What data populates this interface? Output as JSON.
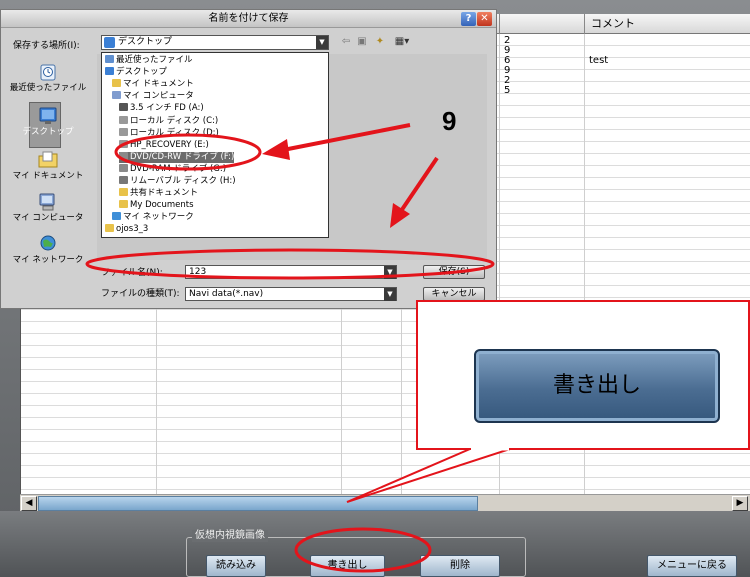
{
  "dialog": {
    "title": "名前を付けて保存",
    "save_in_label": "保存する場所(I):",
    "save_in_value": "デスクトップ",
    "places": [
      {
        "label": "最近使ったファイル",
        "icon": "recent-files-icon"
      },
      {
        "label": "デスクトップ",
        "icon": "desktop-icon"
      },
      {
        "label": "マイ ドキュメント",
        "icon": "my-documents-icon"
      },
      {
        "label": "マイ コンピュータ",
        "icon": "my-computer-icon"
      },
      {
        "label": "マイ ネットワーク",
        "icon": "my-network-icon"
      }
    ],
    "dropdown_items": [
      {
        "label": "最近使ったファイル",
        "icon": "recent-folder-icon",
        "indent": 0,
        "selected": false
      },
      {
        "label": "デスクトップ",
        "icon": "desktop-icon",
        "indent": 0,
        "selected": false
      },
      {
        "label": "マイ ドキュメント",
        "icon": "my-documents-icon",
        "indent": 1,
        "selected": false
      },
      {
        "label": "マイ コンピュータ",
        "icon": "my-computer-icon",
        "indent": 1,
        "selected": false
      },
      {
        "label": "3.5 インチ FD (A:)",
        "icon": "floppy-icon",
        "indent": 2,
        "selected": false
      },
      {
        "label": "ローカル ディスク (C:)",
        "icon": "disk-icon",
        "indent": 2,
        "selected": false
      },
      {
        "label": "ローカル ディスク (D:)",
        "icon": "disk-icon",
        "indent": 2,
        "selected": false
      },
      {
        "label": "HP_RECOVERY (E:)",
        "icon": "disk-icon",
        "indent": 2,
        "selected": false
      },
      {
        "label": "DVD/CD-RW ドライブ (F:)",
        "icon": "dvd-drive-icon",
        "indent": 2,
        "selected": true
      },
      {
        "label": "DVD-RAM ドライブ (G:)",
        "icon": "dvd-drive-icon",
        "indent": 2,
        "selected": false
      },
      {
        "label": "リムーバブル ディスク (H:)",
        "icon": "removable-disk-icon",
        "indent": 2,
        "selected": false
      },
      {
        "label": "共有ドキュメント",
        "icon": "folder-icon",
        "indent": 2,
        "selected": false
      },
      {
        "label": "My Documents",
        "icon": "folder-icon",
        "indent": 2,
        "selected": false
      },
      {
        "label": "マイ ネットワーク",
        "icon": "network-icon",
        "indent": 1,
        "selected": false
      },
      {
        "label": "ojos3_3",
        "icon": "folder-icon",
        "indent": 0,
        "selected": false
      }
    ],
    "filename_label": "ファイル名(N):",
    "filename_value": "123",
    "filetype_label": "ファイルの種類(T):",
    "filetype_value": "Navi data(*.nav)",
    "save_button": "保存(S)",
    "cancel_button": "キャンセル"
  },
  "grid": {
    "comment_header": "コメント",
    "partial_values": [
      "2",
      "9",
      "6",
      "9",
      "2",
      "5"
    ],
    "comment_values": [
      "",
      "",
      "test",
      "",
      "",
      ""
    ]
  },
  "bottom": {
    "group_label": "仮想内視鏡画像",
    "read_button": "読み込み",
    "export_button": "書き出し",
    "delete_button": "削除",
    "menu_button": "メニューに戻る"
  },
  "annotation": {
    "step_number": "9",
    "callout_button_label": "書き出し",
    "color": "#e3141b"
  }
}
